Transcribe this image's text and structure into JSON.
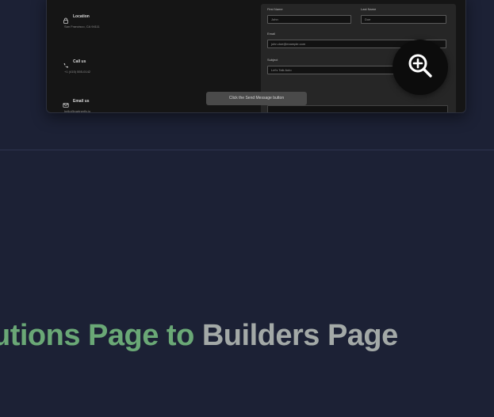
{
  "preview": {
    "contact_items": [
      {
        "title": "Location",
        "value": "San Francisco, CA 94111",
        "icon": "lock-icon"
      },
      {
        "title": "Call us",
        "value": "+1 (415) 555-0142",
        "icon": "phone-icon"
      },
      {
        "title": "Email us",
        "value": "hello@partnerfly.io",
        "icon": "mail-icon"
      }
    ],
    "form": {
      "first_name_label": "First Name",
      "first_name_value": "John",
      "last_name_label": "Last Name",
      "last_name_value": "Doe",
      "email_label": "Email",
      "email_value": "john.doe@example.com",
      "subject_label": "Subject",
      "subject_value": "Let's Talk Auto"
    },
    "tooltip": "Click the Send Message button",
    "zoom_icon": "zoom-in-icon"
  },
  "headline": {
    "part1": "utions Page to ",
    "part2": "Builders Page"
  },
  "colors": {
    "background": "#1c2135",
    "headline_green": "#6aa876",
    "headline_gray": "#a3a9a7"
  }
}
